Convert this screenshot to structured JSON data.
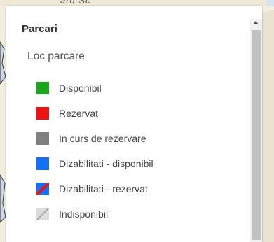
{
  "panel": {
    "title": "Parcari",
    "layer_title": "Loc parcare"
  },
  "legend": {
    "items": [
      {
        "label": "Disponibil",
        "color": "#1aa51a",
        "icon": "green-square-icon"
      },
      {
        "label": "Rezervat",
        "color": "#ee1111",
        "icon": "red-square-icon"
      },
      {
        "label": "In curs de rezervare",
        "color": "#808080",
        "icon": "gray-square-icon"
      },
      {
        "label": "Dizabilitati - disponibil",
        "color": "#1470f5",
        "icon": "blue-square-icon"
      },
      {
        "label": "Dizabilitati - rezervat",
        "color": "#1470f5",
        "accent": "#ee1111",
        "icon": "blue-red-diagonal-icon"
      },
      {
        "label": "Indisponibil",
        "color": "#dddddd",
        "icon": "crossed-square-icon"
      }
    ]
  },
  "map": {
    "street_label_fragment": "ard Sc"
  }
}
